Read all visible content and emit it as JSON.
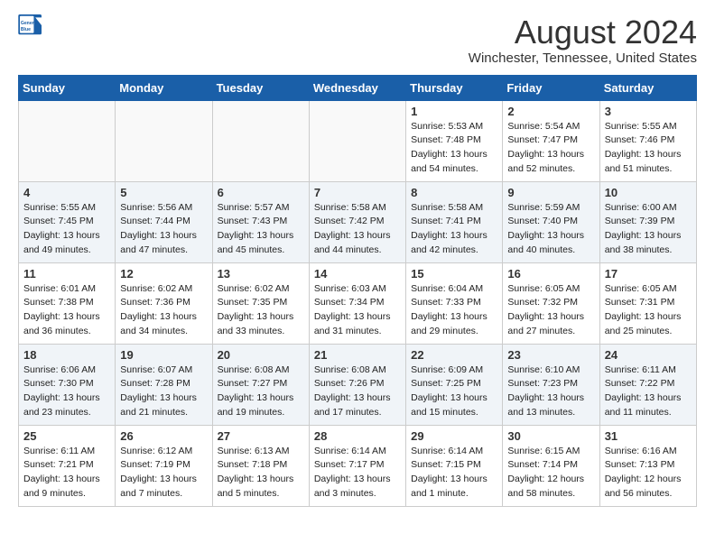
{
  "header": {
    "logo_line1": "General",
    "logo_line2": "Blue",
    "month": "August 2024",
    "location": "Winchester, Tennessee, United States"
  },
  "weekdays": [
    "Sunday",
    "Monday",
    "Tuesday",
    "Wednesday",
    "Thursday",
    "Friday",
    "Saturday"
  ],
  "weeks": [
    [
      {
        "day": "",
        "info": ""
      },
      {
        "day": "",
        "info": ""
      },
      {
        "day": "",
        "info": ""
      },
      {
        "day": "",
        "info": ""
      },
      {
        "day": "1",
        "info": "Sunrise: 5:53 AM\nSunset: 7:48 PM\nDaylight: 13 hours\nand 54 minutes."
      },
      {
        "day": "2",
        "info": "Sunrise: 5:54 AM\nSunset: 7:47 PM\nDaylight: 13 hours\nand 52 minutes."
      },
      {
        "day": "3",
        "info": "Sunrise: 5:55 AM\nSunset: 7:46 PM\nDaylight: 13 hours\nand 51 minutes."
      }
    ],
    [
      {
        "day": "4",
        "info": "Sunrise: 5:55 AM\nSunset: 7:45 PM\nDaylight: 13 hours\nand 49 minutes."
      },
      {
        "day": "5",
        "info": "Sunrise: 5:56 AM\nSunset: 7:44 PM\nDaylight: 13 hours\nand 47 minutes."
      },
      {
        "day": "6",
        "info": "Sunrise: 5:57 AM\nSunset: 7:43 PM\nDaylight: 13 hours\nand 45 minutes."
      },
      {
        "day": "7",
        "info": "Sunrise: 5:58 AM\nSunset: 7:42 PM\nDaylight: 13 hours\nand 44 minutes."
      },
      {
        "day": "8",
        "info": "Sunrise: 5:58 AM\nSunset: 7:41 PM\nDaylight: 13 hours\nand 42 minutes."
      },
      {
        "day": "9",
        "info": "Sunrise: 5:59 AM\nSunset: 7:40 PM\nDaylight: 13 hours\nand 40 minutes."
      },
      {
        "day": "10",
        "info": "Sunrise: 6:00 AM\nSunset: 7:39 PM\nDaylight: 13 hours\nand 38 minutes."
      }
    ],
    [
      {
        "day": "11",
        "info": "Sunrise: 6:01 AM\nSunset: 7:38 PM\nDaylight: 13 hours\nand 36 minutes."
      },
      {
        "day": "12",
        "info": "Sunrise: 6:02 AM\nSunset: 7:36 PM\nDaylight: 13 hours\nand 34 minutes."
      },
      {
        "day": "13",
        "info": "Sunrise: 6:02 AM\nSunset: 7:35 PM\nDaylight: 13 hours\nand 33 minutes."
      },
      {
        "day": "14",
        "info": "Sunrise: 6:03 AM\nSunset: 7:34 PM\nDaylight: 13 hours\nand 31 minutes."
      },
      {
        "day": "15",
        "info": "Sunrise: 6:04 AM\nSunset: 7:33 PM\nDaylight: 13 hours\nand 29 minutes."
      },
      {
        "day": "16",
        "info": "Sunrise: 6:05 AM\nSunset: 7:32 PM\nDaylight: 13 hours\nand 27 minutes."
      },
      {
        "day": "17",
        "info": "Sunrise: 6:05 AM\nSunset: 7:31 PM\nDaylight: 13 hours\nand 25 minutes."
      }
    ],
    [
      {
        "day": "18",
        "info": "Sunrise: 6:06 AM\nSunset: 7:30 PM\nDaylight: 13 hours\nand 23 minutes."
      },
      {
        "day": "19",
        "info": "Sunrise: 6:07 AM\nSunset: 7:28 PM\nDaylight: 13 hours\nand 21 minutes."
      },
      {
        "day": "20",
        "info": "Sunrise: 6:08 AM\nSunset: 7:27 PM\nDaylight: 13 hours\nand 19 minutes."
      },
      {
        "day": "21",
        "info": "Sunrise: 6:08 AM\nSunset: 7:26 PM\nDaylight: 13 hours\nand 17 minutes."
      },
      {
        "day": "22",
        "info": "Sunrise: 6:09 AM\nSunset: 7:25 PM\nDaylight: 13 hours\nand 15 minutes."
      },
      {
        "day": "23",
        "info": "Sunrise: 6:10 AM\nSunset: 7:23 PM\nDaylight: 13 hours\nand 13 minutes."
      },
      {
        "day": "24",
        "info": "Sunrise: 6:11 AM\nSunset: 7:22 PM\nDaylight: 13 hours\nand 11 minutes."
      }
    ],
    [
      {
        "day": "25",
        "info": "Sunrise: 6:11 AM\nSunset: 7:21 PM\nDaylight: 13 hours\nand 9 minutes."
      },
      {
        "day": "26",
        "info": "Sunrise: 6:12 AM\nSunset: 7:19 PM\nDaylight: 13 hours\nand 7 minutes."
      },
      {
        "day": "27",
        "info": "Sunrise: 6:13 AM\nSunset: 7:18 PM\nDaylight: 13 hours\nand 5 minutes."
      },
      {
        "day": "28",
        "info": "Sunrise: 6:14 AM\nSunset: 7:17 PM\nDaylight: 13 hours\nand 3 minutes."
      },
      {
        "day": "29",
        "info": "Sunrise: 6:14 AM\nSunset: 7:15 PM\nDaylight: 13 hours\nand 1 minute."
      },
      {
        "day": "30",
        "info": "Sunrise: 6:15 AM\nSunset: 7:14 PM\nDaylight: 12 hours\nand 58 minutes."
      },
      {
        "day": "31",
        "info": "Sunrise: 6:16 AM\nSunset: 7:13 PM\nDaylight: 12 hours\nand 56 minutes."
      }
    ]
  ]
}
